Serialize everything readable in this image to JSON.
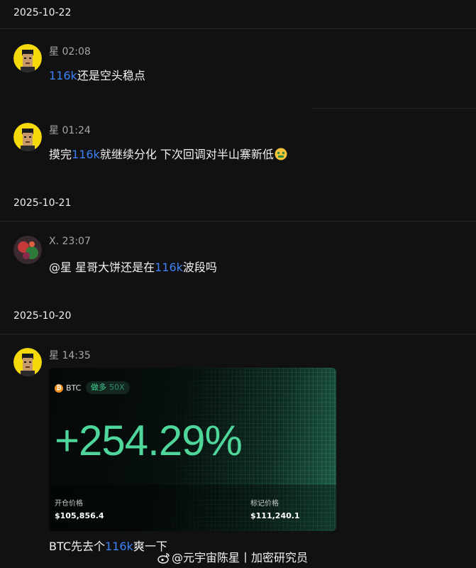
{
  "dates": [
    "2025-10-22",
    "2025-10-21",
    "2025-10-20"
  ],
  "messages": [
    {
      "author": "星",
      "time": "02:08",
      "parts": [
        {
          "t": "116k",
          "hl": true
        },
        {
          "t": "还是空头稳点",
          "hl": false
        }
      ]
    },
    {
      "author": "星",
      "time": "01:24",
      "parts": [
        {
          "t": "摸完",
          "hl": false
        },
        {
          "t": "116k",
          "hl": true
        },
        {
          "t": "就继续分化 下次回调对半山寨新低",
          "hl": false
        }
      ]
    },
    {
      "author": "X.",
      "time": "23:07",
      "parts": [
        {
          "t": "@星 星哥大饼还是在",
          "hl": false
        },
        {
          "t": "116k",
          "hl": true
        },
        {
          "t": "波段吗",
          "hl": false
        }
      ]
    },
    {
      "author": "星",
      "time": "14:35",
      "parts": [
        {
          "t": "BTC先去个",
          "hl": false
        },
        {
          "t": "116k",
          "hl": true
        },
        {
          "t": "爽一下",
          "hl": false
        }
      ]
    }
  ],
  "card": {
    "coin": "BTC",
    "coin_symbol": "₿",
    "side": "做多",
    "leverage": "50X",
    "pnl": "+254.29%",
    "open_label": "开仓价格",
    "open_value": "$105,856.4",
    "mark_label": "标记价格",
    "mark_value": "$111,240.1"
  },
  "watermark": "@元宇宙陈星丨加密研究员",
  "colors": {
    "background": "#111111",
    "highlight": "#3b82f6",
    "pnl": "#4fd69a",
    "meta": "#a6a6a6"
  }
}
